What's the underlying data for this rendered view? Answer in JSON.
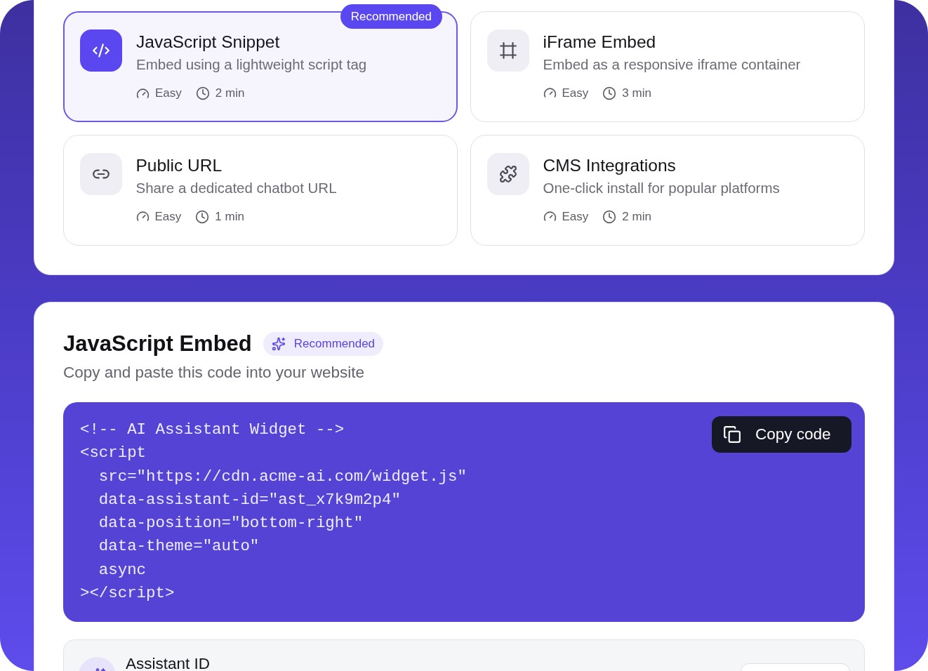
{
  "embed_options": [
    {
      "title": "JavaScript Snippet",
      "description": "Embed using a lightweight script tag",
      "difficulty": "Easy",
      "duration": "2 min",
      "selected": true,
      "badge": "Recommended"
    },
    {
      "title": "iFrame Embed",
      "description": "Embed as a responsive iframe container",
      "difficulty": "Easy",
      "duration": "3 min",
      "selected": false
    },
    {
      "title": "Public URL",
      "description": "Share a dedicated chatbot URL",
      "difficulty": "Easy",
      "duration": "1 min",
      "selected": false
    },
    {
      "title": "CMS Integrations",
      "description": "One-click install for popular platforms",
      "difficulty": "Easy",
      "duration": "2 min",
      "selected": false
    }
  ],
  "embed_panel": {
    "title": "JavaScript Embed",
    "badge": "Recommended",
    "subtitle": "Copy and paste this code into your website",
    "code_lines": [
      "<!-- AI Assistant Widget -->",
      "<script",
      "  src=\"https://cdn.acme-ai.com/widget.js\"",
      "  data-assistant-id=\"ast_x7k9m2p4\"",
      "  data-position=\"bottom-right\"",
      "  data-theme=\"auto\"",
      "  async",
      "></script>"
    ],
    "copy_button": "Copy code",
    "assistant_id": {
      "label": "Assistant ID"
    }
  }
}
